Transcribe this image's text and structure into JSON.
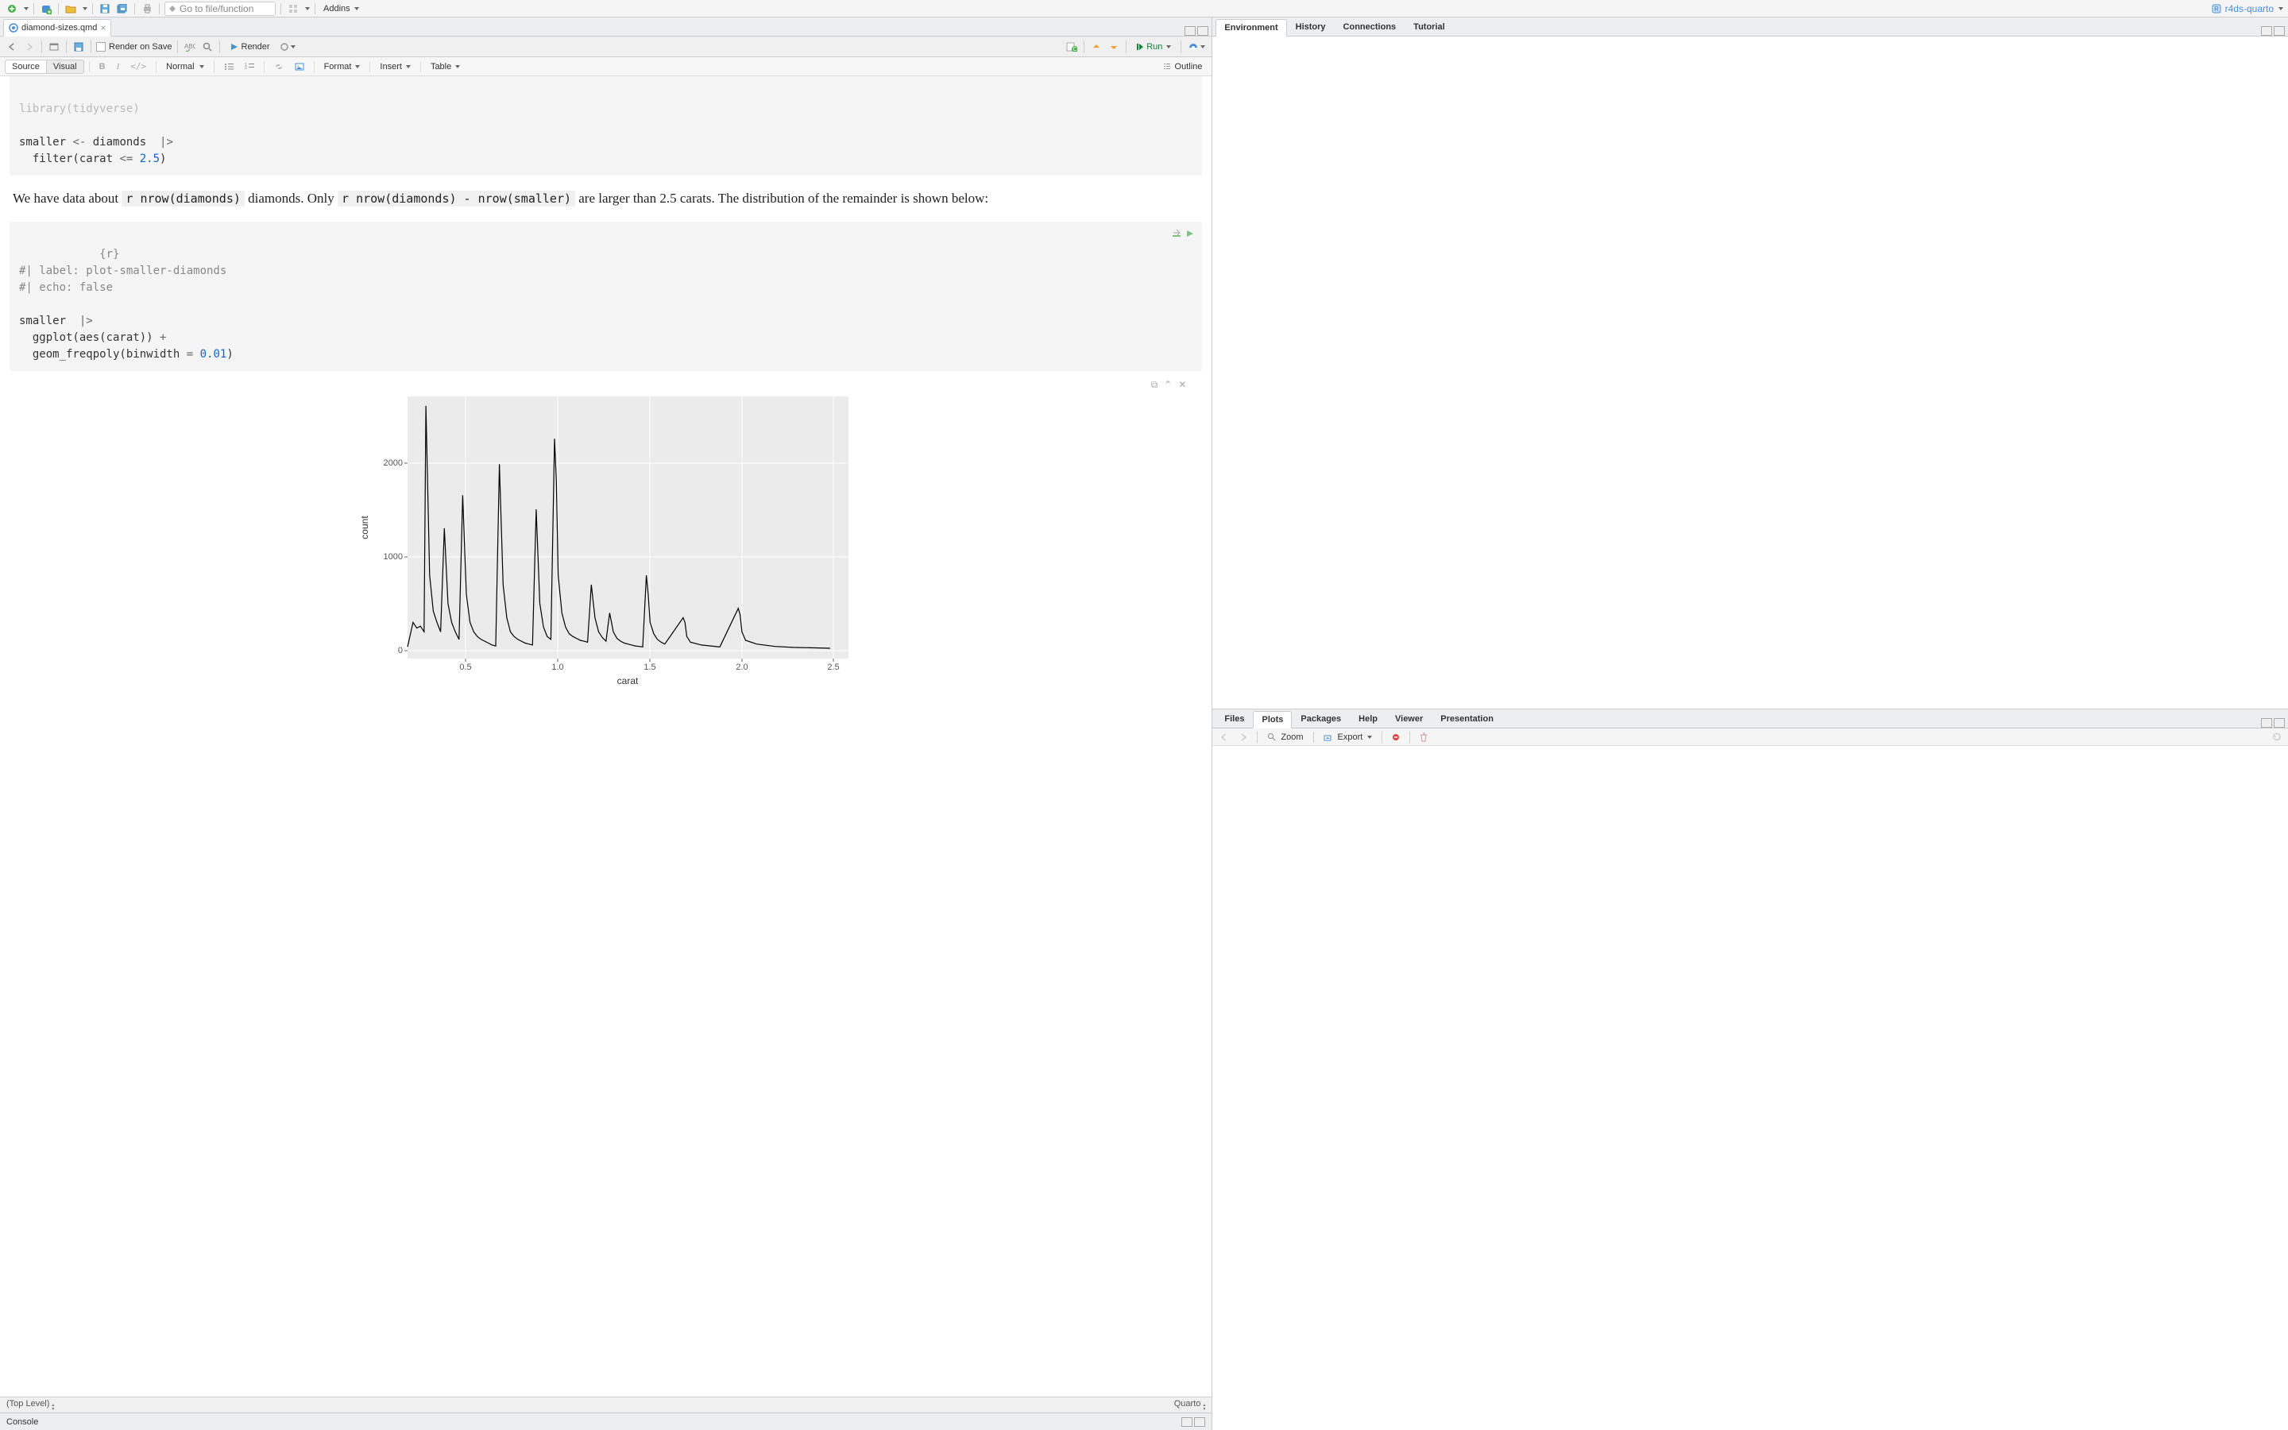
{
  "main_toolbar": {
    "goto_placeholder": "Go to file/function",
    "addins_label": "Addins"
  },
  "project": {
    "name": "r4ds-quarto"
  },
  "editor": {
    "filename": "diamond-sizes.qmd",
    "render_on_save": "Render on Save",
    "render_label": "Render",
    "run_label": "Run",
    "outline_label": "Outline",
    "source_label": "Source",
    "visual_label": "Visual",
    "normal_label": "Normal",
    "format_label": "Format",
    "insert_label": "Insert",
    "table_label": "Table",
    "status_left": "(Top Level)",
    "status_right": "Quarto"
  },
  "code1": {
    "l1": "library(tidyverse)",
    "l2": "",
    "l3_a": "smaller ",
    "l3_b": "<-",
    "l3_c": " diamonds  ",
    "l3_d": "|>",
    "l4_a": "  filter(carat ",
    "l4_b": "<=",
    "l4_c": " ",
    "l4_d": "2.5",
    "l4_e": ")"
  },
  "prose": {
    "p1_a": "We have data about ",
    "p1_code1": "r nrow(diamonds)",
    "p1_b": " diamonds. Only ",
    "p1_code2": "r nrow(diamonds) - nrow(smaller)",
    "p1_c": " are larger than 2.5 carats. The distribution of the remainder is shown below:"
  },
  "code2": {
    "hdr": "{r}",
    "c1": "#| label: plot-smaller-diamonds",
    "c2": "#| echo: false",
    "l1_a": "smaller  ",
    "l1_b": "|>",
    "l2_a": "  ggplot(aes(carat)) ",
    "l2_b": "+",
    "l3_a": "  geom_freqpoly(binwidth ",
    "l3_b": "=",
    "l3_c": " ",
    "l3_d": "0.01",
    "l3_e": ")"
  },
  "plot": {
    "xlabel": "carat",
    "ylabel": "count"
  },
  "right_panel_top": {
    "tabs": [
      "Environment",
      "History",
      "Connections",
      "Tutorial"
    ]
  },
  "right_panel_bottom": {
    "tabs": [
      "Files",
      "Plots",
      "Packages",
      "Help",
      "Viewer",
      "Presentation"
    ],
    "active": "Plots",
    "zoom": "Zoom",
    "export": "Export"
  },
  "console": {
    "label": "Console"
  },
  "chart_data": {
    "type": "line",
    "title": "",
    "xlabel": "carat",
    "ylabel": "count",
    "xlim": [
      0.2,
      2.6
    ],
    "ylim": [
      0,
      2700
    ],
    "y_ticks": [
      0,
      1000,
      2000
    ],
    "x_ticks": [
      0.5,
      1.0,
      1.5,
      2.0,
      2.5
    ],
    "series": [
      {
        "name": "count",
        "x": [
          0.2,
          0.23,
          0.25,
          0.27,
          0.29,
          0.3,
          0.32,
          0.34,
          0.36,
          0.38,
          0.4,
          0.42,
          0.44,
          0.46,
          0.48,
          0.5,
          0.52,
          0.54,
          0.56,
          0.58,
          0.6,
          0.62,
          0.64,
          0.66,
          0.68,
          0.7,
          0.72,
          0.74,
          0.76,
          0.78,
          0.8,
          0.82,
          0.84,
          0.86,
          0.88,
          0.9,
          0.92,
          0.94,
          0.96,
          0.98,
          1.0,
          1.01,
          1.02,
          1.04,
          1.06,
          1.08,
          1.1,
          1.12,
          1.14,
          1.16,
          1.18,
          1.2,
          1.22,
          1.24,
          1.26,
          1.28,
          1.3,
          1.32,
          1.34,
          1.36,
          1.38,
          1.4,
          1.42,
          1.44,
          1.46,
          1.48,
          1.5,
          1.51,
          1.52,
          1.54,
          1.56,
          1.58,
          1.6,
          1.7,
          1.71,
          1.72,
          1.74,
          1.8,
          1.9,
          2.0,
          2.01,
          2.02,
          2.04,
          2.1,
          2.2,
          2.3,
          2.4,
          2.5
        ],
        "y": [
          40,
          300,
          240,
          260,
          200,
          2600,
          800,
          420,
          300,
          200,
          1300,
          500,
          300,
          200,
          120,
          1650,
          600,
          300,
          200,
          150,
          120,
          100,
          80,
          60,
          50,
          1980,
          700,
          350,
          200,
          150,
          120,
          100,
          80,
          70,
          60,
          1500,
          500,
          250,
          150,
          120,
          2250,
          1800,
          800,
          400,
          250,
          180,
          150,
          130,
          110,
          100,
          90,
          700,
          350,
          200,
          140,
          100,
          400,
          200,
          130,
          100,
          80,
          70,
          60,
          50,
          45,
          40,
          800,
          600,
          300,
          180,
          120,
          90,
          70,
          350,
          300,
          150,
          90,
          60,
          40,
          450,
          380,
          200,
          110,
          70,
          45,
          35,
          30,
          25
        ]
      }
    ]
  }
}
